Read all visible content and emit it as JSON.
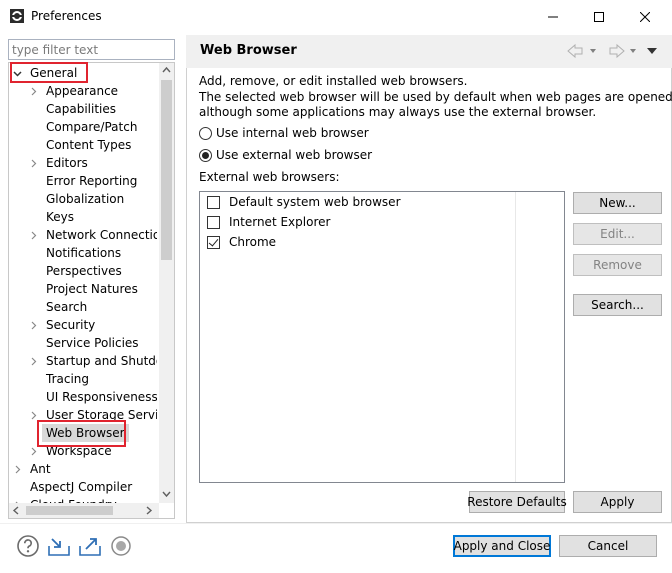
{
  "window": {
    "title": "Preferences",
    "minimize_glyph": "—",
    "maximize_glyph": "☐",
    "close_glyph": "✕"
  },
  "filter": {
    "placeholder": "type filter text",
    "value": ""
  },
  "tree": {
    "items": [
      {
        "label": "General",
        "level": 0,
        "arrow": "expanded"
      },
      {
        "label": "Appearance",
        "level": 1,
        "arrow": "collapsed"
      },
      {
        "label": "Capabilities",
        "level": 1,
        "arrow": "none"
      },
      {
        "label": "Compare/Patch",
        "level": 1,
        "arrow": "none"
      },
      {
        "label": "Content Types",
        "level": 1,
        "arrow": "none"
      },
      {
        "label": "Editors",
        "level": 1,
        "arrow": "collapsed"
      },
      {
        "label": "Error Reporting",
        "level": 1,
        "arrow": "none"
      },
      {
        "label": "Globalization",
        "level": 1,
        "arrow": "none"
      },
      {
        "label": "Keys",
        "level": 1,
        "arrow": "none"
      },
      {
        "label": "Network Connection",
        "level": 1,
        "arrow": "collapsed"
      },
      {
        "label": "Notifications",
        "level": 1,
        "arrow": "none"
      },
      {
        "label": "Perspectives",
        "level": 1,
        "arrow": "none"
      },
      {
        "label": "Project Natures",
        "level": 1,
        "arrow": "none"
      },
      {
        "label": "Search",
        "level": 1,
        "arrow": "none"
      },
      {
        "label": "Security",
        "level": 1,
        "arrow": "collapsed"
      },
      {
        "label": "Service Policies",
        "level": 1,
        "arrow": "none"
      },
      {
        "label": "Startup and Shutdown",
        "level": 1,
        "arrow": "collapsed"
      },
      {
        "label": "Tracing",
        "level": 1,
        "arrow": "none"
      },
      {
        "label": "UI Responsiveness M",
        "level": 1,
        "arrow": "none"
      },
      {
        "label": "User Storage Service",
        "level": 1,
        "arrow": "collapsed"
      },
      {
        "label": "Web Browser",
        "level": 1,
        "arrow": "none",
        "selected": true
      },
      {
        "label": "Workspace",
        "level": 1,
        "arrow": "collapsed"
      },
      {
        "label": "Ant",
        "level": 0,
        "arrow": "collapsed"
      },
      {
        "label": "AspectJ Compiler",
        "level": 0,
        "arrow": "none"
      },
      {
        "label": "Cloud Foundry",
        "level": 0,
        "arrow": "collapsed"
      }
    ]
  },
  "page": {
    "title": "Web Browser",
    "description_line1": "Add, remove, or edit installed web browsers.",
    "description_line2": "The selected web browser will be used by default when web pages are opened,",
    "description_line3": "although some applications may always use the external browser.",
    "radio_internal": "Use internal web browser",
    "radio_external": "Use external web browser",
    "selected_radio": "external",
    "list_label": "External web browsers:",
    "browsers": [
      {
        "label": "Default system web browser",
        "checked": false
      },
      {
        "label": "Internet Explorer",
        "checked": false
      },
      {
        "label": "Chrome",
        "checked": true
      }
    ],
    "buttons": {
      "new": "New...",
      "edit": "Edit...",
      "remove": "Remove",
      "search": "Search...",
      "restore_defaults": "Restore Defaults",
      "apply": "Apply"
    }
  },
  "footer": {
    "apply_and_close": "Apply and Close",
    "cancel": "Cancel"
  },
  "colors": {
    "highlight_border": "#e0242f",
    "default_button_border": "#0078d7",
    "icon_blue": "#2f6fb5"
  }
}
